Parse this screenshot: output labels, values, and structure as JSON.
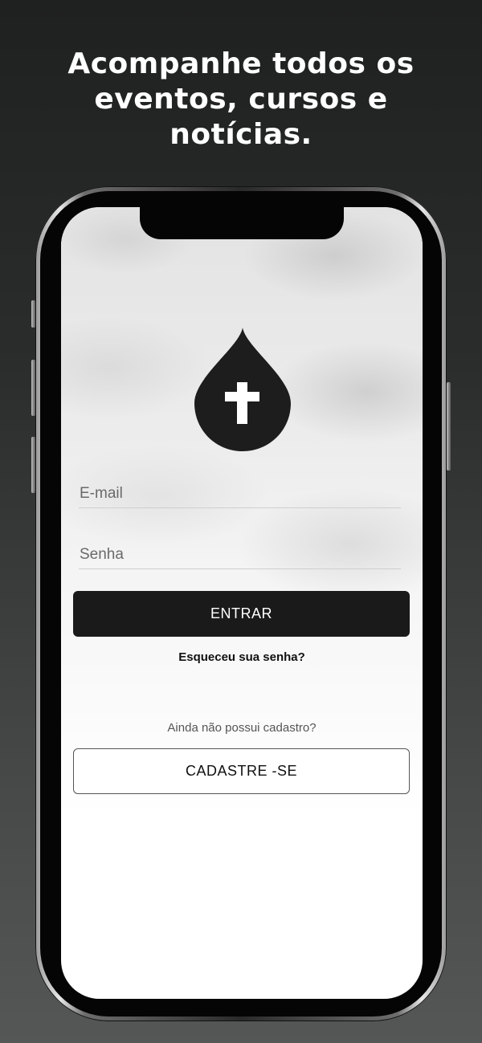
{
  "headline": {
    "line1": "Acompanhe todos os",
    "line2": "eventos, cursos e",
    "line3": "notícias."
  },
  "login": {
    "logo_icon": "drop-with-cross-icon",
    "email_placeholder": "E-mail",
    "password_placeholder": "Senha",
    "enter_button": "ENTRAR",
    "forgot_password": "Esqueceu sua senha?",
    "no_account_text": "Ainda não possui cadastro?",
    "signup_button": "CADASTRE -SE"
  },
  "colors": {
    "primary": "#1a1a1a",
    "background_top": "#1f2020",
    "background_bottom": "#555757"
  }
}
